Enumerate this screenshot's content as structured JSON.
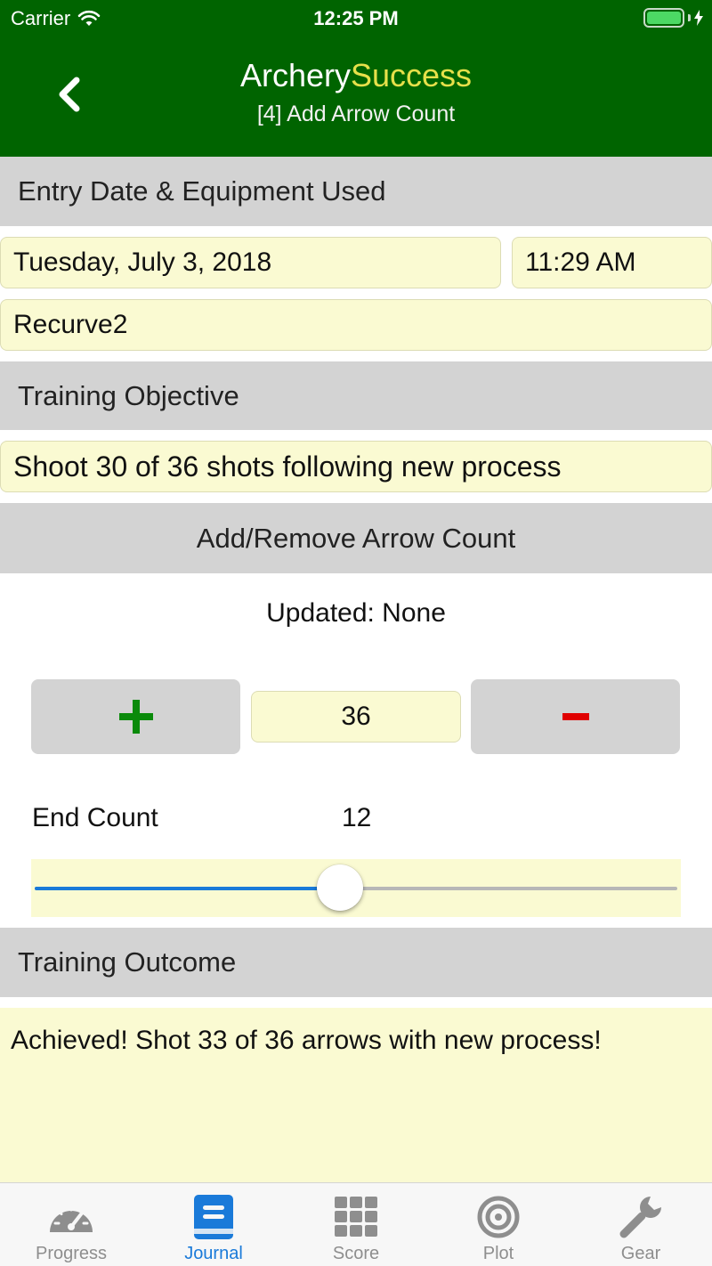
{
  "status_bar": {
    "carrier": "Carrier",
    "time": "12:25 PM"
  },
  "header": {
    "title_part1": "Archery",
    "title_part2": "Success",
    "subtitle": "[4] Add Arrow Count"
  },
  "sections": {
    "entry": "Entry Date & Equipment Used",
    "objective": "Training Objective",
    "arrow_count": "Add/Remove Arrow Count",
    "outcome": "Training Outcome"
  },
  "entry": {
    "date": "Tuesday, July 3, 2018",
    "time": "11:29 AM",
    "equipment": "Recurve2"
  },
  "objective": "Shoot 30 of 36 shots following new process",
  "arrow_count": {
    "updated": "Updated: None",
    "count": "36",
    "end_count_label": "End Count",
    "end_count_value": "12",
    "slider_fraction": 0.475
  },
  "outcome_text": "Achieved! Shot 33 of 36 arrows with new process!",
  "tabs": [
    {
      "label": "Progress",
      "icon": "speedometer-icon"
    },
    {
      "label": "Journal",
      "icon": "book-icon"
    },
    {
      "label": "Score",
      "icon": "grid-icon"
    },
    {
      "label": "Plot",
      "icon": "target-icon"
    },
    {
      "label": "Gear",
      "icon": "wrench-icon"
    }
  ],
  "colors": {
    "header_green": "#006400",
    "title_accent": "#e6e04a",
    "field_yellow": "#fafad2",
    "section_gray": "#d3d3d3",
    "plus_green": "#0a8a0a",
    "minus_red": "#e00000",
    "active_blue": "#1a7ad9"
  }
}
